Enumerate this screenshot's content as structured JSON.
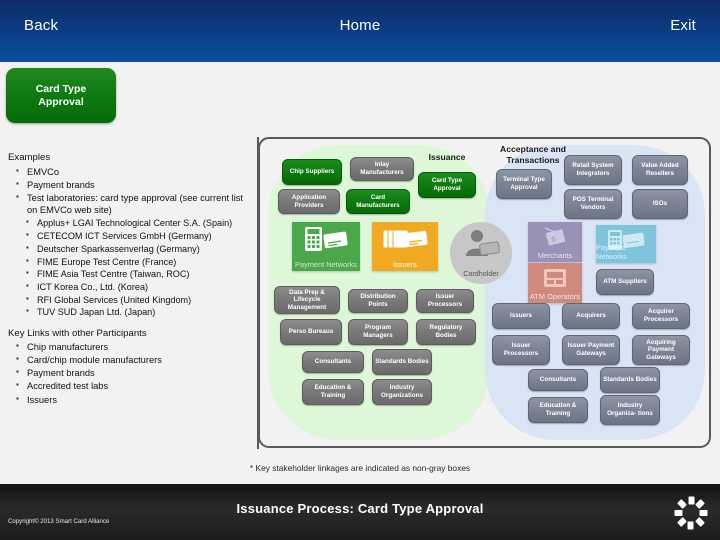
{
  "topbar": {
    "back": "Back",
    "home": "Home",
    "exit": "Exit"
  },
  "title_badge": {
    "line1": "Card Type",
    "line2": "Approval"
  },
  "left_panel": {
    "examples_heading": "Examples",
    "examples": [
      "EMVCo",
      "Payment brands",
      "Test laboratories: card type approval (see current list on EMVCo web site)"
    ],
    "test_labs": [
      "Applus+ LGAI Technological Center S.A. (Spain)",
      "CETECOM ICT Services GmbH (Germany)",
      "Deutscher Sparkassenverlag (Germany)",
      "FIME Europe Test Centre (France)",
      "FIME Asia Test Centre (Taiwan, ROC)",
      "ICT Korea Co., Ltd. (Korea)",
      "RFI Global Services (United Kingdom)",
      "TUV SUD Japan Ltd. (Japan)"
    ],
    "keylinks_heading": "Key Links with other Participants",
    "keylinks": [
      "Chip manufacturers",
      "Card/chip module manufacturers",
      "Payment brands",
      "Accredited test labs",
      "Issuers"
    ]
  },
  "diagram": {
    "issuance_zone": {
      "heading": "Issuance",
      "nodes": [
        {
          "label": "Chip Suppliers",
          "style": "green"
        },
        {
          "label": "Inlay Manufacturers",
          "style": "gray"
        },
        {
          "label": "Card Type Approval",
          "style": "green"
        },
        {
          "label": "Application Providers",
          "style": "gray"
        },
        {
          "label": "Card Manufacturers",
          "style": "green"
        },
        {
          "label": "Data Prep & Lifecycle Management",
          "style": "gray"
        },
        {
          "label": "Distribution Points",
          "style": "gray"
        },
        {
          "label": "Issuer Processors",
          "style": "gray"
        },
        {
          "label": "Perso Bureaus",
          "style": "gray"
        },
        {
          "label": "Program Managers",
          "style": "gray"
        },
        {
          "label": "Regulatory Bodies",
          "style": "gray"
        },
        {
          "label": "Consultants",
          "style": "gray"
        },
        {
          "label": "Standards Bodies",
          "style": "gray"
        },
        {
          "label": "Education & Training",
          "style": "gray"
        },
        {
          "label": "Industry Organizations",
          "style": "gray"
        }
      ],
      "tiles": [
        {
          "label": "Payment Networks",
          "icon": "terminal-card-icon",
          "style": "tile-green"
        },
        {
          "label": "Issuers",
          "icon": "cards-stack-icon",
          "style": "tile-orange"
        }
      ]
    },
    "cardholder": {
      "label": "Cardholder",
      "icon": "person-card-icon"
    },
    "acceptance_zone": {
      "heading_line1": "Acceptance and",
      "heading_line2": "Transactions",
      "nodes": [
        {
          "label": "Terminal Type Approval",
          "style": "gray-blue"
        },
        {
          "label": "Retail System Integrators",
          "style": "gray-blue"
        },
        {
          "label": "Value Added Resellers",
          "style": "gray-blue"
        },
        {
          "label": "POS Terminal Vendors",
          "style": "gray-blue"
        },
        {
          "label": "ISOs",
          "style": "gray-blue"
        },
        {
          "label": "ATM Suppliers",
          "style": "gray-blue"
        },
        {
          "label": "Issuers",
          "style": "gray-blue"
        },
        {
          "label": "Acquirers",
          "style": "gray-blue"
        },
        {
          "label": "Acquirer Processors",
          "style": "gray-blue"
        },
        {
          "label": "Issuer Processors",
          "style": "gray-blue"
        },
        {
          "label": "Issuer Payment Gateways",
          "style": "gray-blue"
        },
        {
          "label": "Acquiring Payment Gateways",
          "style": "gray-blue"
        },
        {
          "label": "Consultants",
          "style": "gray-blue"
        },
        {
          "label": "Standards Bodies",
          "style": "gray-blue"
        },
        {
          "label": "Education & Training",
          "style": "gray-blue"
        },
        {
          "label": "Industry Organiza- tions",
          "style": "gray-blue"
        }
      ],
      "tiles": [
        {
          "label": "Merchants",
          "icon": "shop-sign-icon",
          "style": "tile-purple"
        },
        {
          "label": "Payment Networks",
          "icon": "terminal-card-icon",
          "style": "tile-lblue"
        },
        {
          "label": "ATM Operators",
          "icon": "atm-machine-icon",
          "style": "tile-salmon"
        }
      ]
    }
  },
  "footnote": "* Key stakeholder linkages are indicated as non-gray boxes",
  "bottombar": {
    "title": "Issuance Process:  Card Type Approval",
    "copyright": "Copyright© 2013 Smart Card Alliance"
  },
  "colors": {
    "nav_blue": "#0b3e86",
    "badge_green": "#0e7a12",
    "green_zone": "#ddf7d8",
    "blue_zone": "#d9e4f5",
    "gray_node": "#7a7a7a",
    "gray_blue_node": "#7c8495",
    "issuers_orange": "#efaa22",
    "footer_black": "#1c1c1c"
  }
}
